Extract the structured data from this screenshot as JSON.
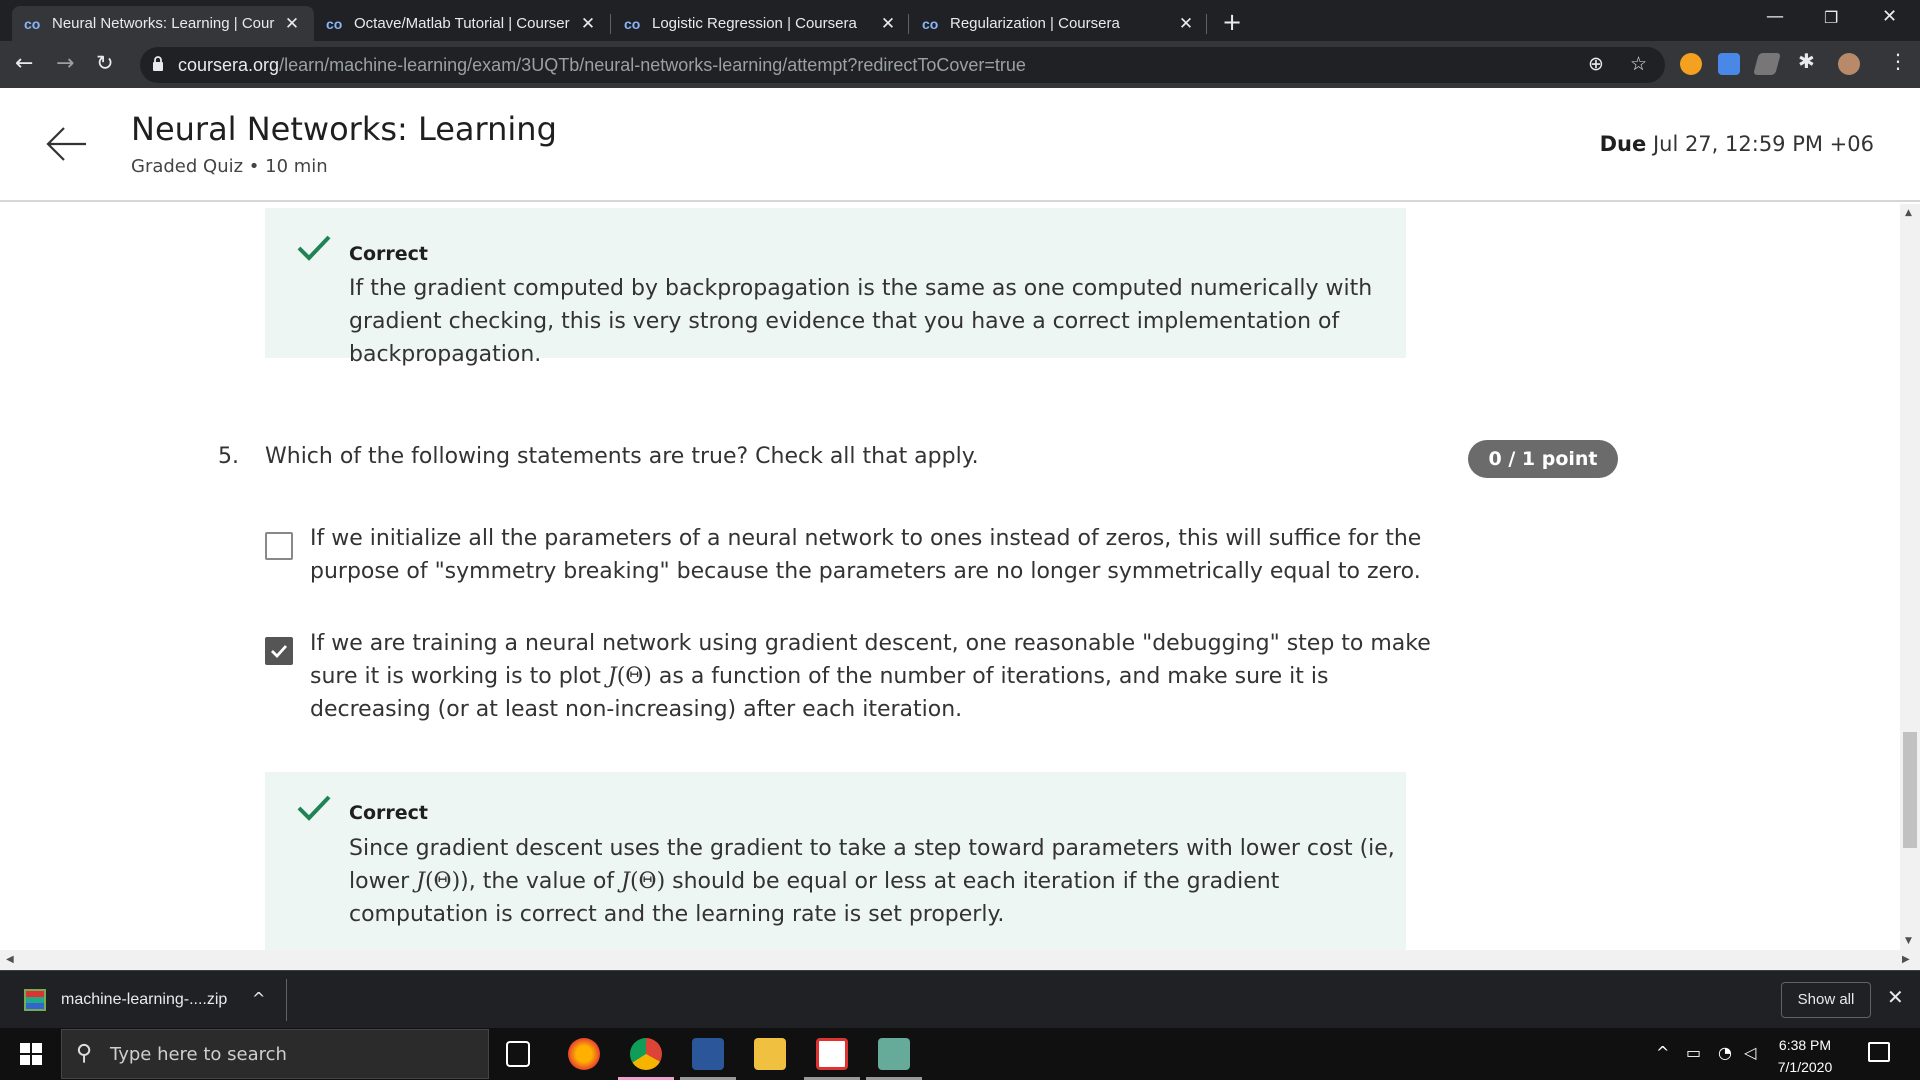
{
  "browser": {
    "tabs": [
      {
        "label": "Neural Networks: Learning | Cour",
        "active": true
      },
      {
        "label": "Octave/Matlab Tutorial | Courser",
        "active": false
      },
      {
        "label": "Logistic Regression | Coursera",
        "active": false
      },
      {
        "label": "Regularization | Coursera",
        "active": false
      }
    ],
    "tab_favicon": "co",
    "tab_close": "✕",
    "new_tab": "+",
    "url_host": "coursera.org",
    "url_path": "/learn/machine-learning/exam/3UQTb/neural-networks-learning/attempt?redirectToCover=true"
  },
  "header": {
    "title": "Neural Networks: Learning",
    "subtitle": "Graded Quiz • 10 min",
    "due_label": "Due",
    "due_value": "Jul 27, 12:59 PM +06"
  },
  "quiz": {
    "prev_feedback": {
      "status": "Correct",
      "text": "If the gradient computed by backpropagation is the same as one computed numerically with gradient checking, this is very strong evidence that you have a correct implementation of backpropagation."
    },
    "question": {
      "number": "5.",
      "text": "Which of the following statements are true? Check all that apply.",
      "score": "0 / 1 point",
      "options": [
        {
          "checked": false,
          "text": "If we initialize all the parameters of a neural network to ones instead of zeros, this will suffice for the purpose of \"symmetry breaking\" because the parameters are no longer symmetrically equal to zero."
        },
        {
          "checked": true,
          "text_a": "If we are training a neural network using gradient descent, one reasonable \"debugging\" step to make sure it is working is to plot ",
          "text_b": " as a function of the number of iterations, and make sure it is decreasing (or at least non-increasing) after each iteration."
        }
      ],
      "feedback": {
        "status": "Correct",
        "text_a": "Since gradient descent uses the gradient to take a step toward parameters with lower cost (ie, lower ",
        "text_b": "), the value of ",
        "text_c": " should be equal or less at each iteration if the gradient computation is correct and the learning rate is set properly."
      }
    },
    "math_J": "J",
    "math_theta": "(Θ)"
  },
  "downloads": {
    "file": "machine-learning-....zip",
    "show_all": "Show all"
  },
  "taskbar": {
    "search_placeholder": "Type here to search",
    "time": "6:38 PM",
    "date": "7/1/2020"
  },
  "colors": {
    "correct_green": "#1f8354",
    "feedback_bg": "#eef6f3",
    "score_pill": "#6b6b6b"
  }
}
